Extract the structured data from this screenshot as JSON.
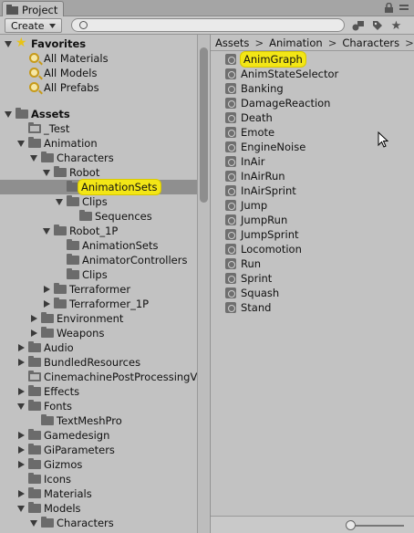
{
  "window": {
    "tab_title": "Project"
  },
  "toolbar": {
    "create_label": "Create",
    "search_placeholder": ""
  },
  "favorites": {
    "label": "Favorites",
    "items": [
      "All Materials",
      "All Models",
      "All Prefabs"
    ]
  },
  "assets_label": "Assets",
  "tree": [
    {
      "label": "_Test"
    },
    {
      "label": "Animation"
    },
    {
      "label": "Characters"
    },
    {
      "label": "Robot"
    },
    {
      "label": "AnimationSets"
    },
    {
      "label": "Clips"
    },
    {
      "label": "Sequences"
    },
    {
      "label": "Robot_1P"
    },
    {
      "label": "AnimationSets"
    },
    {
      "label": "AnimatorControllers"
    },
    {
      "label": "Clips"
    },
    {
      "label": "Terraformer"
    },
    {
      "label": "Terraformer_1P"
    },
    {
      "label": "Environment"
    },
    {
      "label": "Weapons"
    },
    {
      "label": "Audio"
    },
    {
      "label": "BundledResources"
    },
    {
      "label": "CinemachinePostProcessingV"
    },
    {
      "label": "Effects"
    },
    {
      "label": "Fonts"
    },
    {
      "label": "TextMeshPro"
    },
    {
      "label": "Gamedesign"
    },
    {
      "label": "GiParameters"
    },
    {
      "label": "Gizmos"
    },
    {
      "label": "Icons"
    },
    {
      "label": "Materials"
    },
    {
      "label": "Models"
    },
    {
      "label": "Characters"
    }
  ],
  "breadcrumb": [
    "Assets",
    "Animation",
    "Characters"
  ],
  "assets_list": [
    "AnimGraph",
    "AnimStateSelector",
    "Banking",
    "DamageReaction",
    "Death",
    "Emote",
    "EngineNoise",
    "InAir",
    "InAirRun",
    "InAirSprint",
    "Jump",
    "JumpRun",
    "JumpSprint",
    "Locomotion",
    "Run",
    "Sprint",
    "Squash",
    "Stand"
  ],
  "icon_slider": {
    "value": 0.0
  },
  "colors": {
    "highlight": "#f3e616",
    "selection": "#8f8f8f",
    "panel": "#c2c2c2"
  }
}
